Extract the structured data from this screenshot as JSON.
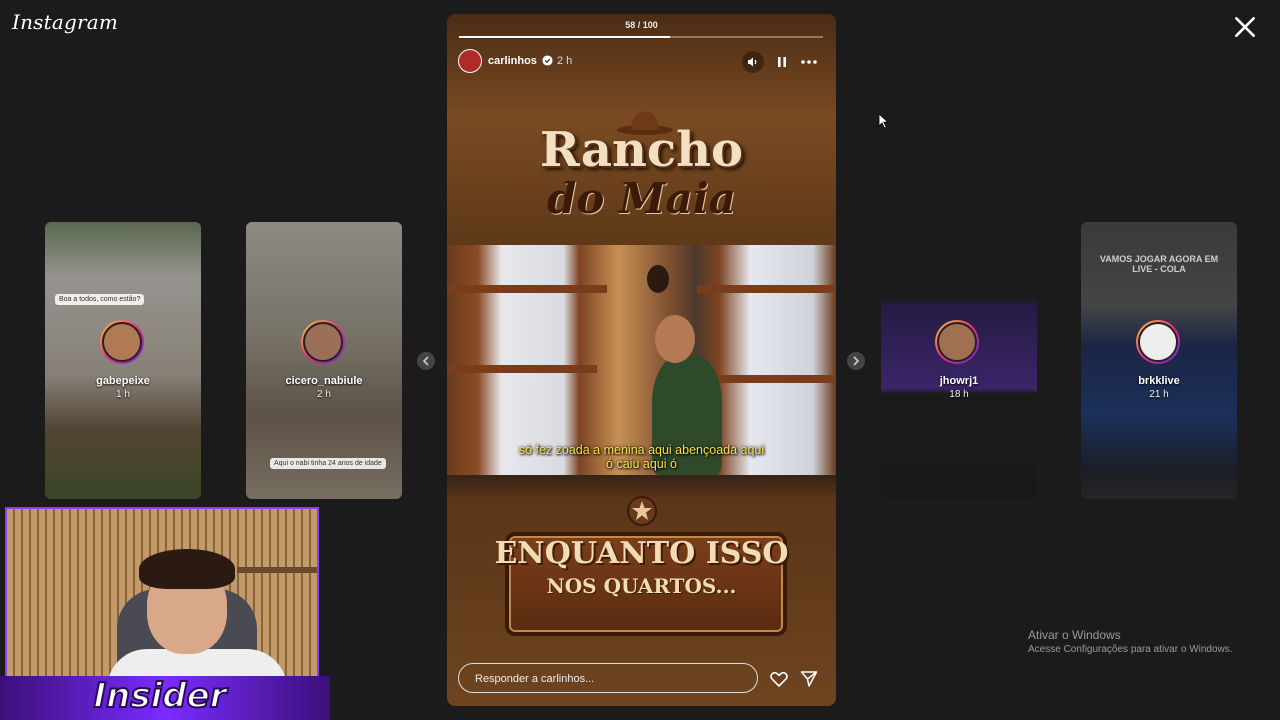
{
  "app": {
    "logo": "Instagram"
  },
  "story": {
    "counter": "58 / 100",
    "progress": 0.58,
    "user": "carlinhos",
    "time": "2 h",
    "title_line1": "Rancho",
    "title_line2": "do Maia",
    "subtitle_line1": "só fez zoada a menina aqui abençoada aqui",
    "subtitle_line2": "ó caiu aqui ó",
    "sign_line1": "ENQUANTO ISSO",
    "sign_line2": "NOS QUARTOS...",
    "reply_placeholder": "Responder a carlinhos..."
  },
  "left_cards": [
    {
      "user": "gabepeixe",
      "time": "1 h",
      "caption": "Boa a todos, como estão?"
    },
    {
      "user": "cicero_nabiule",
      "time": "2 h",
      "caption": "Aqui o nabi tinha 24 anos de idade"
    }
  ],
  "right_cards": [
    {
      "user": "jhowrj1",
      "time": "18 h"
    },
    {
      "user": "brkklive",
      "time": "21 h",
      "caption": "VAMOS JOGAR AGORA EM LIVE - COLA"
    }
  ],
  "watermark": {
    "line1": "Ativar o Windows",
    "line2": "Acesse Configurações para ativar o Windows."
  },
  "overlay": {
    "brand": "Insider"
  },
  "colors": {
    "background": "#1b1b1b",
    "subtitle": "#f4e04a",
    "banner": "#7a2cff"
  },
  "icons": [
    "close-icon",
    "sound-icon",
    "pause-icon",
    "more-icon",
    "heart-icon",
    "send-icon",
    "chevron-left-icon",
    "chevron-right-icon",
    "verified-icon"
  ]
}
